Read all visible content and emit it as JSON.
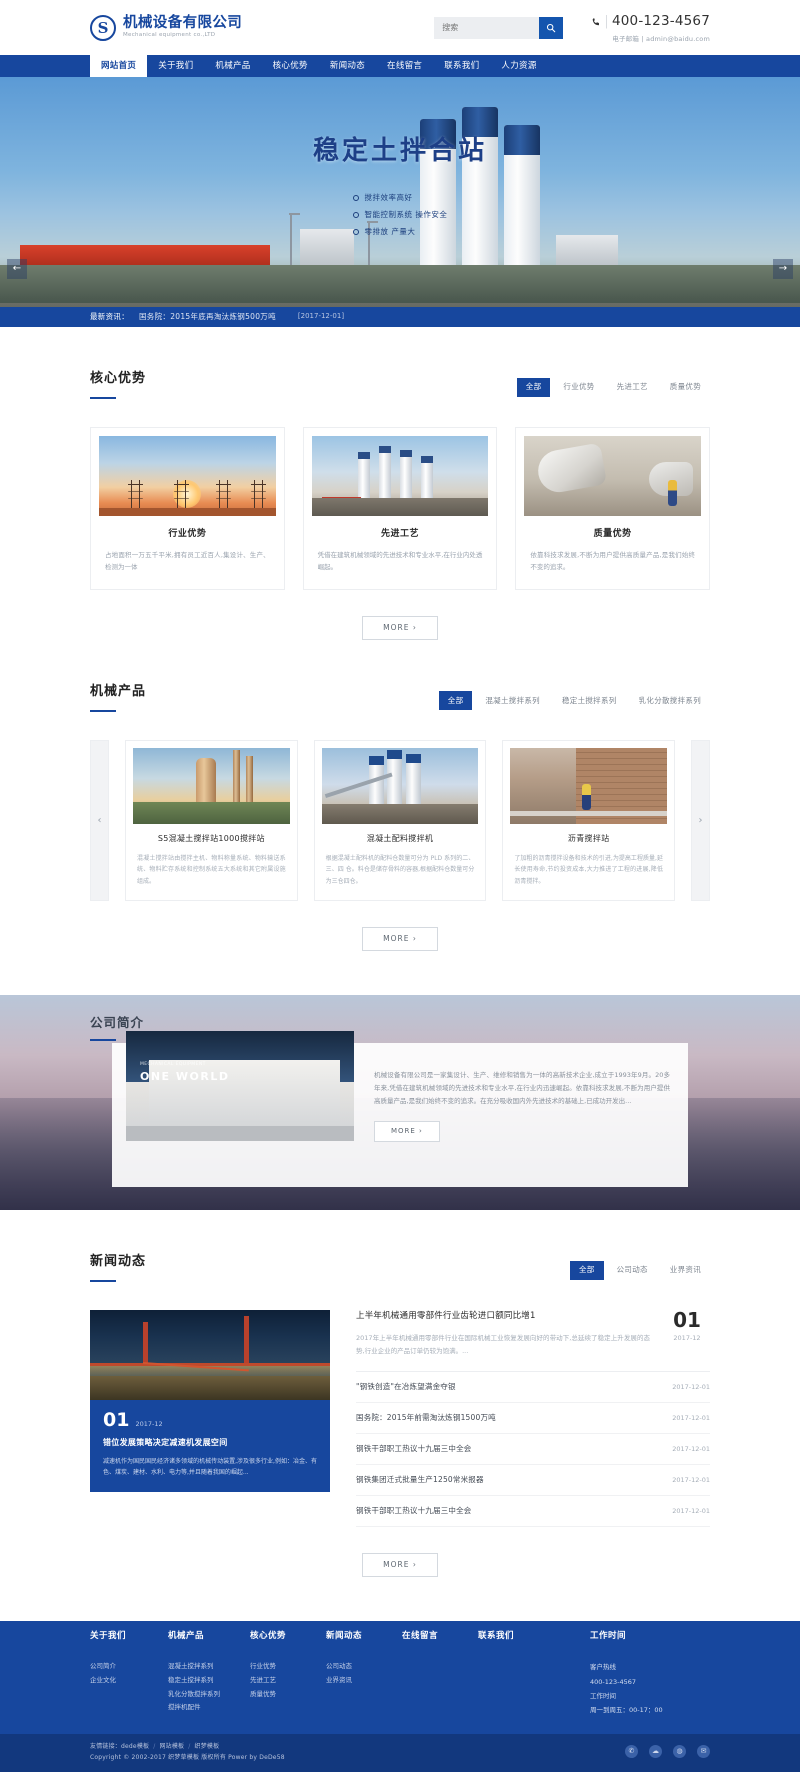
{
  "header": {
    "logo_cn": "机械设备有限公司",
    "logo_en": "Mechanical equipment co.,LTD",
    "logo_mark": "S",
    "search_placeholder": "搜索",
    "search_icon": "search-icon",
    "phone_icon": "phone-icon",
    "phone": "400-123-4567",
    "email_label": "电子邮箱",
    "email": "admin@baidu.com"
  },
  "nav": {
    "items": [
      {
        "label": "网站首页",
        "active": true
      },
      {
        "label": "关于我们",
        "active": false
      },
      {
        "label": "机械产品",
        "active": false
      },
      {
        "label": "核心优势",
        "active": false
      },
      {
        "label": "新闻动态",
        "active": false
      },
      {
        "label": "在线留言",
        "active": false
      },
      {
        "label": "联系我们",
        "active": false
      },
      {
        "label": "人力资源",
        "active": false
      }
    ]
  },
  "hero": {
    "title": "稳定土拌合站",
    "bullets": [
      "搅拌效率高好",
      "智能控制系统 操作安全",
      "零排放 产量大"
    ],
    "prev_icon": "arrow-left-icon",
    "next_icon": "arrow-right-icon",
    "prev_label": "←",
    "next_label": "→"
  },
  "ticker": {
    "label": "最新资讯：",
    "text": "国务院：2015年底再淘汰炼钢500万吨",
    "date": "[2017-12-01]"
  },
  "advantages": {
    "title": "核心优势",
    "tabs": [
      {
        "label": "全部",
        "active": true
      },
      {
        "label": "行业优势",
        "active": false
      },
      {
        "label": "先进工艺",
        "active": false
      },
      {
        "label": "质量优势",
        "active": false
      }
    ],
    "cards": [
      {
        "title": "行业优势",
        "desc": "占地面积一万五千平米,拥有员工近百人,集设计、生产、检测为一体"
      },
      {
        "title": "先进工艺",
        "desc": "凭借在建筑机械领域的先进技术和专业水平,在行业内处透崛起。"
      },
      {
        "title": "质量优势",
        "desc": "依靠科技求发展,不断为用户提供高质量产品,是我们始终不变的追求。"
      }
    ],
    "more_label": "MORE ›"
  },
  "products": {
    "title": "机械产品",
    "tabs": [
      {
        "label": "全部",
        "active": true
      },
      {
        "label": "混凝土搅拌系列",
        "active": false
      },
      {
        "label": "稳定土搅拌系列",
        "active": false
      },
      {
        "label": "乳化分散搅拌系列",
        "active": false
      }
    ],
    "prev_label": "‹",
    "next_label": "›",
    "items": [
      {
        "title": "S5混凝土搅拌站1000搅拌站",
        "desc": "混凝土搅拌站由搅拌主机、物料称量系统、物料输送系统、物料贮存系统和控制系统五大系统和其它附属设施组成。"
      },
      {
        "title": "混凝土配料搅拌机",
        "desc": "根据混凝土配料机的配料仓数量可分为 PLD 系列的二、三、四 仓。料仓是储存骨料的容器,根据配料仓数量可分为三仓四仓。"
      },
      {
        "title": "沥青搅拌站",
        "desc": "了加粗的沥青搅拌设备和技术的引进,为提高工程质量,延长使用寿命,节约投资成本,大力推进了工程的进展,降低沥青搅拌。"
      }
    ],
    "more_label": "MORE ›"
  },
  "about": {
    "title": "公司简介",
    "photo_sub": "MECHANICAL EQUIPMENT",
    "photo_main": "ONE WORLD",
    "desc": "机械设备有限公司是一家集设计、生产、维修和销售为一体的高新技术企业,成立于1993年9月。20多年来,凭借在建筑机械领域的先进技术和专业水平,在行业内迅速崛起。依靠科技求发展,不断为用户提供高质量产品,是我们始终不变的追求。在充分吸收国内外先进技术的基础上,已成功开发出...",
    "more_label": "MORE ›"
  },
  "news": {
    "title": "新闻动态",
    "tabs": [
      {
        "label": "全部",
        "active": true
      },
      {
        "label": "公司动态",
        "active": false
      },
      {
        "label": "业界资讯",
        "active": false
      }
    ],
    "feature": {
      "day": "01",
      "month_year": "2017-12",
      "title": "错位发展策略决定减速机发展空间",
      "desc": "减速机作为国民国民经济诸多领域的机械传动装置,涉及很多行业,例如：冶金、有色、煤炭、建材、水利、电力等,并且随着我国的崛起..."
    },
    "top": {
      "title": "上半年机械通用零部件行业齿轮进口额同比增1",
      "desc": "2017年上半年机械通用零部件行业在国际机械工业恢复发展向好的带动下,总延续了稳定上升发展的态势,行业企业的产品订单仍较为饱满。...",
      "day": "01",
      "month_year": "2017-12"
    },
    "items": [
      {
        "title": "\"钢铁创造\"在冶炼望满金夺银",
        "date": "2017-12-01"
      },
      {
        "title": "国务院：2015年前需淘汰炼钢1500万吨",
        "date": "2017-12-01"
      },
      {
        "title": "钢铁干部职工热议十九届三中全会",
        "date": "2017-12-01"
      },
      {
        "title": "钢铁集团迁式批量生产1250常米报器",
        "date": "2017-12-01"
      },
      {
        "title": "钢铁干部职工热议十九届三中全会",
        "date": "2017-12-01"
      }
    ],
    "more_label": "MORE ›"
  },
  "footer": {
    "columns": [
      {
        "heading": "关于我们",
        "links": [
          "公司简介",
          "企业文化"
        ]
      },
      {
        "heading": "机械产品",
        "links": [
          "混凝土搅拌系列",
          "稳定土搅拌系列",
          "乳化分散搅拌系列",
          "搅拌机配件"
        ]
      },
      {
        "heading": "核心优势",
        "links": [
          "行业优势",
          "先进工艺",
          "质量优势"
        ]
      },
      {
        "heading": "新闻动态",
        "links": [
          "公司动态",
          "业界资讯"
        ]
      },
      {
        "heading": "在线留言",
        "links": []
      },
      {
        "heading": "联系我们",
        "links": []
      }
    ],
    "hours_heading": "工作时间",
    "hours_lines": [
      "客户热线",
      "400-123-4567",
      "工作时间",
      "周一到周五：00-17：00"
    ]
  },
  "subfooter": {
    "friend_label": "友情链接",
    "friend_links": [
      "dede模板",
      "网站模板",
      "织梦模板"
    ],
    "copyright": "Copyright © 2002-2017 织梦草模板 版权所有 Power by DeDe58",
    "icons": [
      "wechat-icon",
      "weibo-icon",
      "qq-icon",
      "rss-icon"
    ],
    "icon_glyphs": [
      "✆",
      "☁",
      "◍",
      "✉"
    ]
  }
}
